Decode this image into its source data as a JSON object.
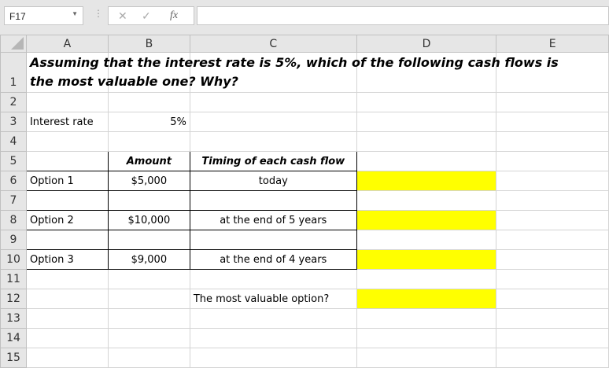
{
  "name_box": "F17",
  "formula_icons": [
    "cancel-icon",
    "enter-icon",
    "fx-icon"
  ],
  "columns": [
    "A",
    "B",
    "C",
    "D",
    "E"
  ],
  "rows": [
    "1",
    "2",
    "3",
    "4",
    "5",
    "6",
    "7",
    "8",
    "9",
    "10",
    "11",
    "12",
    "13",
    "14",
    "15"
  ],
  "cells": {
    "A1": "Assuming that the interest rate is 5%, which of the following cash flows is the most valuable one? Why?",
    "A3": "Interest rate",
    "B3": "5%",
    "B5": "Amount",
    "C5": "Timing of each cash flow",
    "A6": "Option 1",
    "B6": "$5,000",
    "C6": "today",
    "A8": "Option 2",
    "B8": "$10,000",
    "C8": "at the end of 5 years",
    "A10": "Option 3",
    "B10": "$9,000",
    "C10": "at the end of 4 years",
    "C12": "The most valuable option?"
  },
  "highlight_color": "#ffff00"
}
